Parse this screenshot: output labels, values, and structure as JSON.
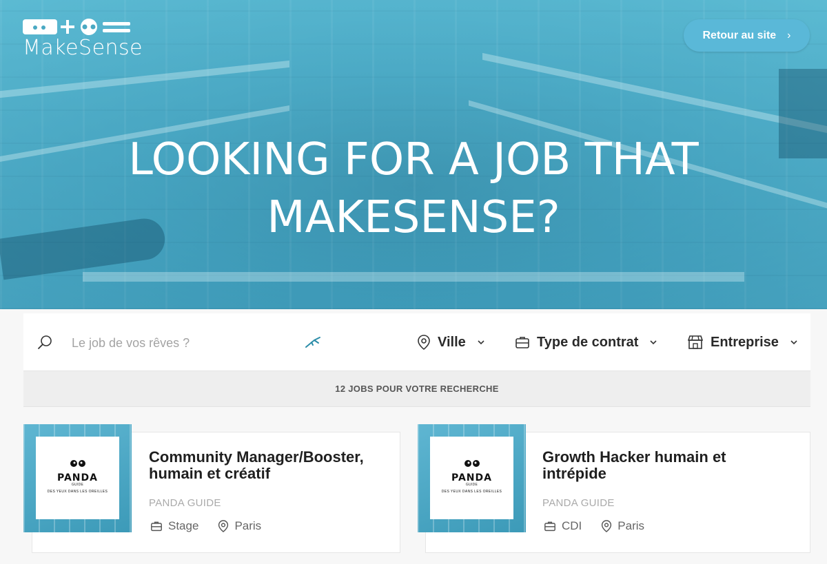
{
  "header": {
    "logo_text": "MakeSense",
    "back_button_label": "Retour au site",
    "back_button_chevron": "›"
  },
  "hero": {
    "title_line1": "LOOKING FOR A JOB THAT",
    "title_line2": "MAKESENSE?"
  },
  "search": {
    "placeholder": "Le job de vos rêves ?",
    "icons": [
      "search-icon",
      "magic-spark-icon"
    ]
  },
  "filters": [
    {
      "label": "Ville",
      "icon": "location-pin-icon"
    },
    {
      "label": "Type de contrat",
      "icon": "briefcase-icon"
    },
    {
      "label": "Entreprise",
      "icon": "storefront-icon"
    }
  ],
  "results": {
    "summary": "12 JOBS POUR VOTRE RECHERCHE"
  },
  "jobs": [
    {
      "title": "Community Manager/Booster, humain et créatif",
      "company": "PANDA GUIDE",
      "contract": "Stage",
      "city": "Paris",
      "logo_word": "PANDA",
      "logo_sub": "GUIDE",
      "logo_tagline": "DES YEUX DANS LES OREILLES"
    },
    {
      "title": "Growth Hacker humain et intrépide",
      "company": "PANDA GUIDE",
      "contract": "CDI",
      "city": "Paris",
      "logo_word": "PANDA",
      "logo_sub": "GUIDE",
      "logo_tagline": "DES YEUX DANS LES OREILLES"
    }
  ],
  "colors": {
    "brand_blue": "#5ab8d8",
    "hero_overlay": "#4aa9c3",
    "accent_teal": "#2a8ca8"
  }
}
